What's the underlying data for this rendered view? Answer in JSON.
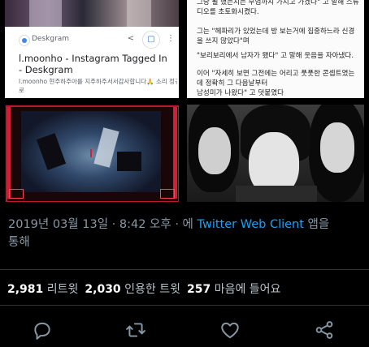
{
  "result_card": {
    "domain": "Deskgram",
    "share_icon": "share-icon",
    "bookmark_icon": "bookmark-icon",
    "more_icon": "more-vertical-icon",
    "title": "l.moonho - Instagram Tagged In - Deskgram",
    "snippet": "l.moonho 현주하주아를 지주하주서서감사합니다🙏 소리 정규음",
    "snippet2": "로"
  },
  "article_lines": [
    "그냥 될 했는지는 무엄까지 가지고 가겠다\" 고 말해 스튜",
    "디오를 초토화시켰다.",
    "",
    "그는 \"헤파리가 있었는데 방 보는거에 집중하느라 신경",
    "을 쓰지 않았다\"며",
    "\"보리보리에서 남자가 됐다\" 고 말해 웃음을 자아냈다.",
    "",
    "이어 \"자세히 보면 그전에는 어리고 풋풋한 콘셉트였는",
    "데 정확히 그 다음날부터",
    "남성미가 나왔다\" 고 덧붙였다"
  ],
  "tweet_meta": {
    "date": "2019년 03월 13일",
    "separator": " · ",
    "time": "8:42 오후",
    "via_prefix": " · 에 ",
    "client": "Twitter Web Client",
    "via_suffix": " 앱을",
    "line2": "통해"
  },
  "stats": {
    "retweets_count": "2,981",
    "retweets_label": "리트윗",
    "quotes_count": "2,030",
    "quotes_label": "인용한 트윗",
    "likes_count": "257",
    "likes_label": "마음에 들어요"
  },
  "actions": [
    "reply-icon",
    "retweet-icon",
    "like-icon",
    "share-icon"
  ],
  "colors": {
    "background": "#000000",
    "meta_text": "#8899a6",
    "link": "#1da1f2",
    "icon": "#8899a6"
  }
}
